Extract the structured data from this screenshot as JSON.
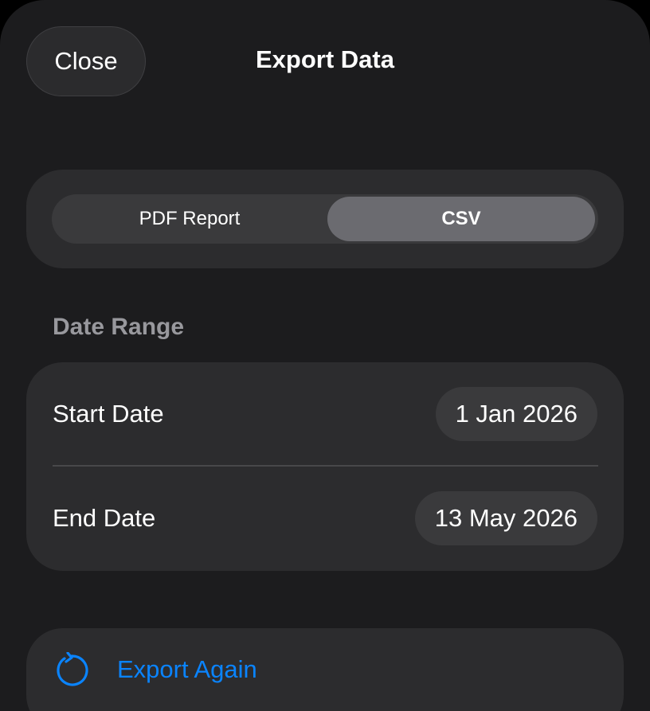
{
  "header": {
    "close_label": "Close",
    "title": "Export Data"
  },
  "format": {
    "options": [
      "PDF Report",
      "CSV"
    ],
    "selected": "CSV"
  },
  "date_range": {
    "section_title": "Date Range",
    "start_label": "Start Date",
    "start_value": "1 Jan 2026",
    "end_label": "End Date",
    "end_value": "13 May 2026"
  },
  "actions": {
    "export_again_label": "Export Again",
    "export_again_icon": "arrow-counterclockwise-icon"
  },
  "colors": {
    "background": "#1c1c1e",
    "card": "#2c2c2e",
    "accent": "#0a84ff",
    "selected_segment": "#6b6b70"
  }
}
